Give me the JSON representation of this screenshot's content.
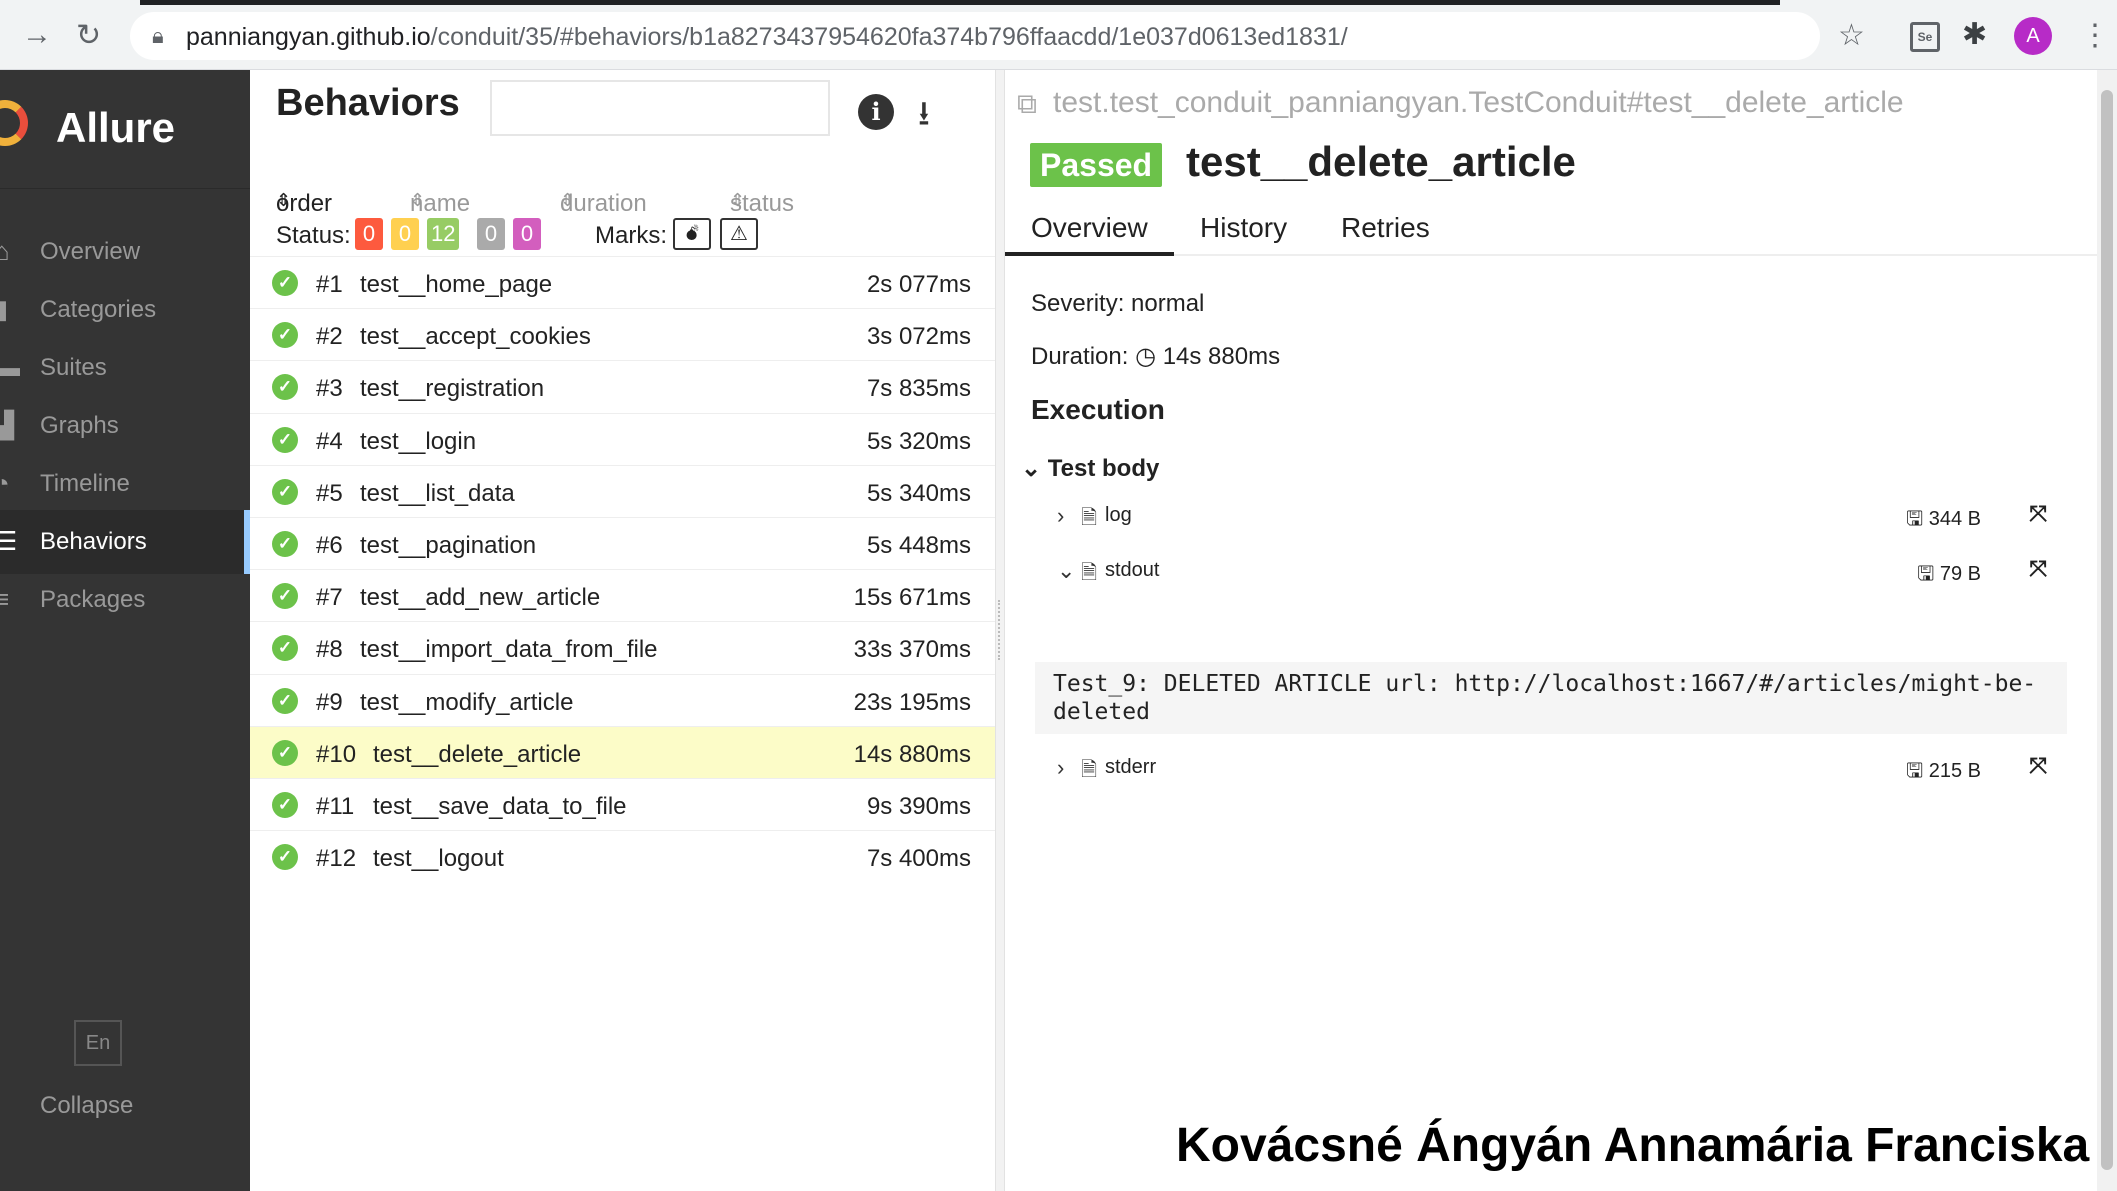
{
  "browser": {
    "url_host": "panniangyan.github.io",
    "url_path": "/conduit/35/#behaviors/b1a8273437954620fa374b796ffaacdd/1e037d0613ed1831/",
    "profile_initial": "A",
    "ext_label": "Se"
  },
  "sidebar": {
    "brand": "Allure",
    "items": [
      {
        "label": "Overview",
        "icon": "home-icon"
      },
      {
        "label": "Categories",
        "icon": "flag-icon"
      },
      {
        "label": "Suites",
        "icon": "briefcase-icon"
      },
      {
        "label": "Graphs",
        "icon": "bar-chart-icon"
      },
      {
        "label": "Timeline",
        "icon": "clock-icon"
      },
      {
        "label": "Behaviors",
        "icon": "list-icon"
      },
      {
        "label": "Packages",
        "icon": "tree-icon"
      }
    ],
    "active": "Behaviors",
    "lang": "En",
    "collapse": "Collapse"
  },
  "behaviors": {
    "title": "Behaviors",
    "sort": [
      "order",
      "name",
      "duration",
      "status"
    ],
    "status_label": "Status:",
    "status_counts": [
      {
        "value": "0",
        "color": "#fd5a3e"
      },
      {
        "value": "0",
        "color": "#ffd050"
      },
      {
        "value": "12",
        "color": "#97cc64"
      },
      {
        "value": "0",
        "color": "#aaaaaa"
      },
      {
        "value": "0",
        "color": "#d35ebe"
      }
    ],
    "marks_label": "Marks:",
    "rows": [
      {
        "num": "#1",
        "name": "test__home_page",
        "duration": "2s 077ms"
      },
      {
        "num": "#2",
        "name": "test__accept_cookies",
        "duration": "3s 072ms"
      },
      {
        "num": "#3",
        "name": "test__registration",
        "duration": "7s 835ms"
      },
      {
        "num": "#4",
        "name": "test__login",
        "duration": "5s 320ms"
      },
      {
        "num": "#5",
        "name": "test__list_data",
        "duration": "5s 340ms"
      },
      {
        "num": "#6",
        "name": "test__pagination",
        "duration": "5s 448ms"
      },
      {
        "num": "#7",
        "name": "test__add_new_article",
        "duration": "15s 671ms"
      },
      {
        "num": "#8",
        "name": "test__import_data_from_file",
        "duration": "33s 370ms"
      },
      {
        "num": "#9",
        "name": "test__modify_article",
        "duration": "23s 195ms"
      },
      {
        "num": "#10",
        "name": "test__delete_article",
        "duration": "14s 880ms"
      },
      {
        "num": "#11",
        "name": "test__save_data_to_file",
        "duration": "9s 390ms"
      },
      {
        "num": "#12",
        "name": "test__logout",
        "duration": "7s 400ms"
      }
    ]
  },
  "detail": {
    "full_path": "test.test_conduit_panniangyan.TestConduit#test__delete_article",
    "status": "Passed",
    "name": "test__delete_article",
    "tabs": [
      "Overview",
      "History",
      "Retries"
    ],
    "severity": "Severity: normal",
    "duration_label": "Duration:",
    "duration": "14s 880ms",
    "execution": "Execution",
    "test_body": "Test body",
    "attachments": [
      {
        "name": "log",
        "size": "344 B"
      },
      {
        "name": "stdout",
        "size": "79 B"
      },
      {
        "name": "stderr",
        "size": "215 B"
      }
    ],
    "stdout_line1": "Test_9: DELETED ARTICLE url: http://localhost:1667/#/articles/might-be-",
    "stdout_line2": "deleted"
  },
  "caption": "Kovácsné Ángyán Annamária Franciska"
}
